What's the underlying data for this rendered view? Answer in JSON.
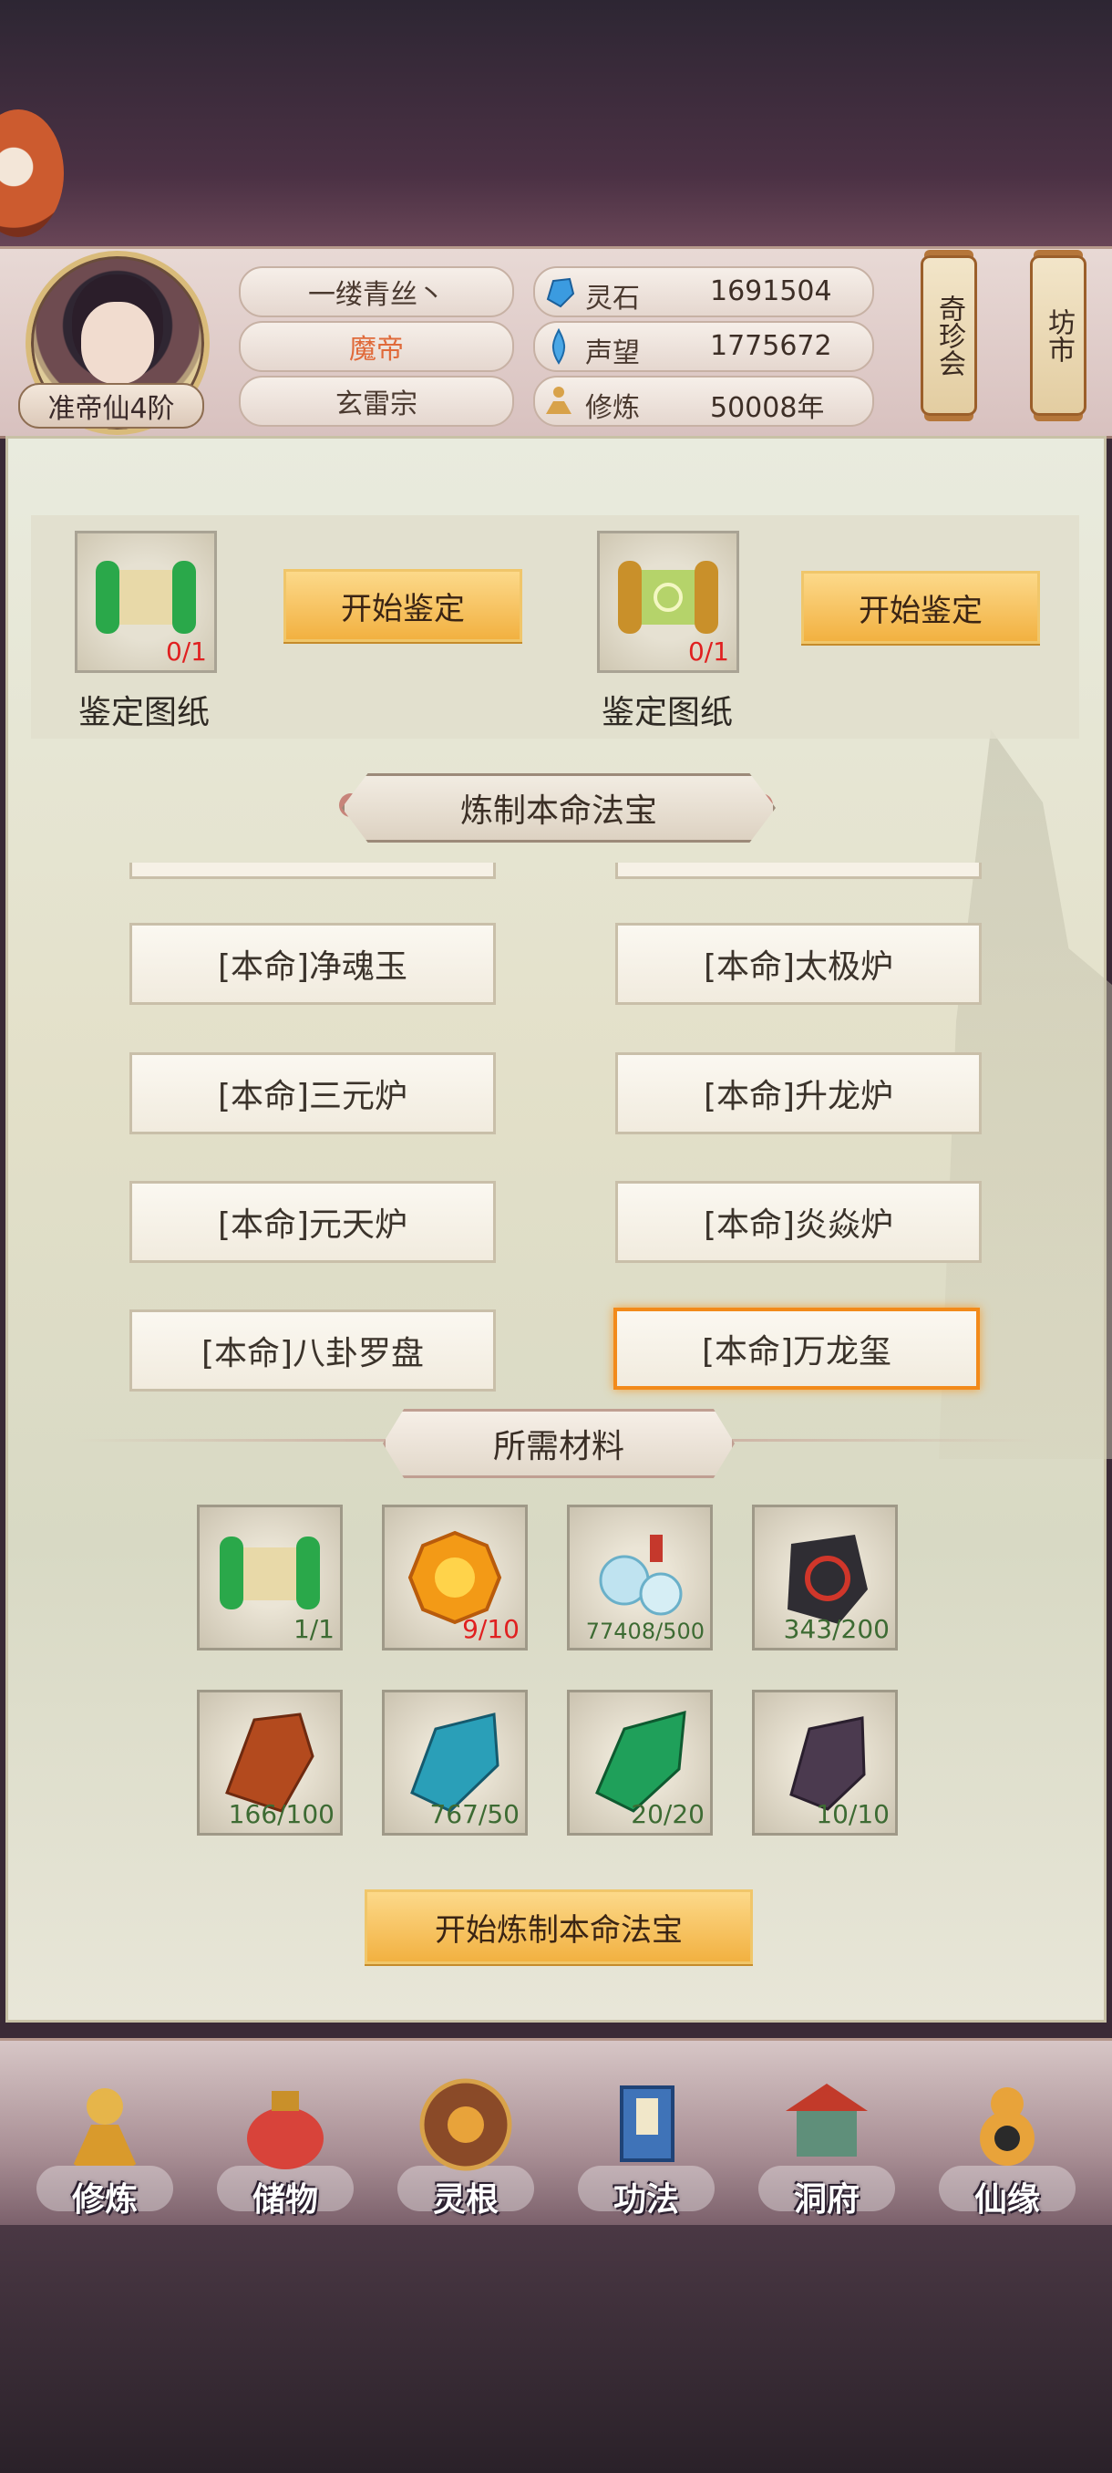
{
  "player": {
    "name": "一缕青丝丶",
    "title": "魔帝",
    "sect": "玄雷宗",
    "rank": "准帝仙4阶"
  },
  "stats": [
    {
      "label": "灵石",
      "value": "1691504",
      "icon": "spirit-stone-icon",
      "color": "#3b9be0"
    },
    {
      "label": "声望",
      "value": "1775672",
      "icon": "prestige-crystal-icon",
      "color": "#4aa7e6"
    },
    {
      "label": "修炼",
      "value": "50008年",
      "icon": "meditation-icon",
      "color": "#d8a24a"
    }
  ],
  "side_buttons": [
    {
      "label": "奇珍会"
    },
    {
      "label": "坊市"
    }
  ],
  "identify": [
    {
      "label": "鉴定图纸",
      "count": "0/1",
      "button": "开始鉴定",
      "icon": "green-scroll-icon"
    },
    {
      "label": "鉴定图纸",
      "count": "0/1",
      "button": "开始鉴定",
      "icon": "gold-scroll-icon"
    }
  ],
  "section_title": "炼制本命法宝",
  "recipes": [
    {
      "label": "[本命]净魂玉"
    },
    {
      "label": "[本命]太极炉"
    },
    {
      "label": "[本命]三元炉"
    },
    {
      "label": "[本命]升龙炉"
    },
    {
      "label": "[本命]元天炉"
    },
    {
      "label": "[本命]炎焱炉"
    },
    {
      "label": "[本命]八卦罗盘"
    },
    {
      "label": "[本命]万龙玺",
      "selected": true
    }
  ],
  "materials_title": "所需材料",
  "materials": [
    {
      "icon": "green-scroll-icon",
      "count": "1/1",
      "status": "ok"
    },
    {
      "icon": "orange-gem-icon",
      "count": "9/10",
      "status": "lack"
    },
    {
      "icon": "spirit-bottles-icon",
      "count": "77408/500",
      "status": "ok"
    },
    {
      "icon": "black-rune-stone-icon",
      "count": "343/200",
      "status": "ok"
    },
    {
      "icon": "red-ore-icon",
      "count": "166/100",
      "status": "ok"
    },
    {
      "icon": "blue-crystal-icon",
      "count": "767/50",
      "status": "ok"
    },
    {
      "icon": "green-crystal-icon",
      "count": "20/20",
      "status": "ok"
    },
    {
      "icon": "purple-crystal-icon",
      "count": "10/10",
      "status": "ok"
    }
  ],
  "craft_button": "开始炼制本命法宝",
  "nav": [
    {
      "label": "修炼",
      "icon": "cultivator-icon"
    },
    {
      "label": "储物",
      "icon": "storage-bag-icon"
    },
    {
      "label": "灵根",
      "icon": "spirit-root-icon"
    },
    {
      "label": "功法",
      "icon": "technique-book-icon"
    },
    {
      "label": "洞府",
      "icon": "cave-mansion-icon"
    },
    {
      "label": "仙缘",
      "icon": "fortune-gourd-icon"
    }
  ]
}
